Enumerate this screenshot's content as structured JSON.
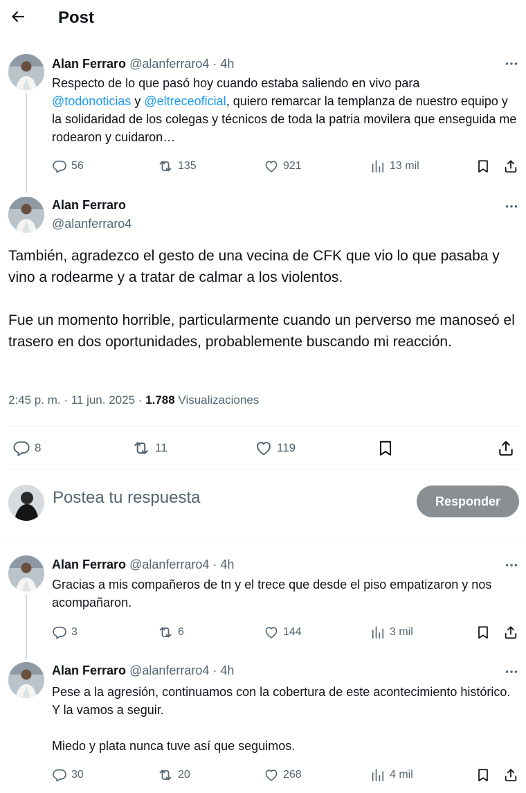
{
  "header": {
    "title": "Post"
  },
  "author": {
    "name": "Alan Ferraro",
    "handle": "@alanferraro4"
  },
  "tweet1": {
    "time": "· 4h",
    "text_1": "Respecto de lo que pasó hoy cuando estaba saliendo en vivo para",
    "mention_1": "@todonoticias",
    "text_2": " y ",
    "mention_2": "@eltreceoficial",
    "text_3": ", quiero remarcar la templanza de nuestro equipo y la solidaridad de los colegas y técnicos de toda la patria movilera que enseguida me rodearon y cuidaron…",
    "replies": "56",
    "reposts": "135",
    "likes": "921",
    "views": "13 mil"
  },
  "main_tweet": {
    "paragraph_1": "También, agradezco el gesto de una vecina de CFK que vio lo que pasaba y vino a rodearme y a tratar de calmar a los violentos.",
    "paragraph_2": "Fue un momento horrible, particularmente cuando un perverso me manoseó el trasero en dos oportunidades, probablemente buscando mi reacción.",
    "timestamp": "2:45 p. m. · 11 jun. 2025 · ",
    "views_count": "1.788",
    "views_label": " Visualizaciones",
    "replies": "8",
    "reposts": "11",
    "likes": "119"
  },
  "reply_box": {
    "placeholder": "Postea tu respuesta",
    "button": "Responder"
  },
  "tweet3": {
    "time": "· 4h",
    "text": "Gracias a mis compañeros de tn y el trece que desde el piso empatizaron y nos acompañaron.",
    "replies": "3",
    "reposts": "6",
    "likes": "144",
    "views": "3 mil"
  },
  "tweet4": {
    "time": "· 4h",
    "paragraph_1": "Pese a la agresión, continuamos con la cobertura de este acontecimiento histórico. Y la vamos a seguir.",
    "paragraph_2": "Miedo y plata nunca tuve así que seguimos.",
    "replies": "30",
    "reposts": "20",
    "likes": "268",
    "views": "4 mil"
  },
  "colors": {
    "text": "#0f1419",
    "secondary": "#536471",
    "link": "#1d9bf0",
    "button": "#8a8f94"
  }
}
